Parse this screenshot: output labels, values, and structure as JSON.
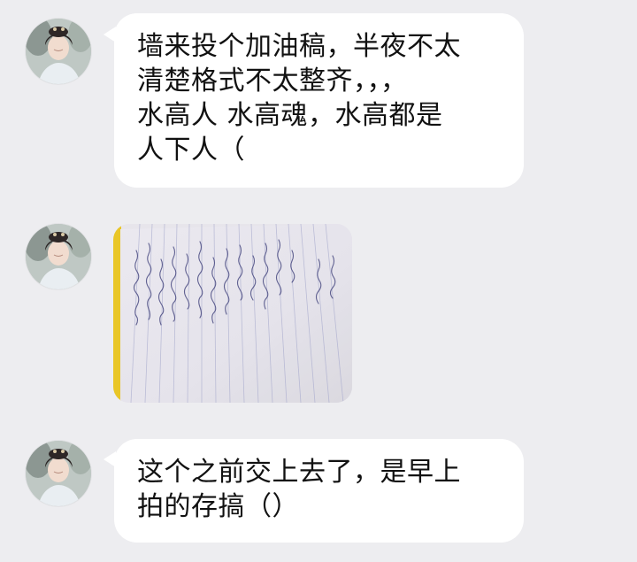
{
  "conversation": {
    "messages": [
      {
        "type": "text",
        "lines": [
          "墙来投个加油稿，半夜不太",
          "清楚格式不太整齐，，，",
          "水高人 水高魂，水高都是",
          "人下人（"
        ]
      },
      {
        "type": "image",
        "image_description": "handwritten notebook page"
      },
      {
        "type": "text",
        "lines": [
          "这个之前交上去了，是早上",
          "拍的存搞（）"
        ]
      }
    ]
  },
  "colors": {
    "background": "#ededf0",
    "bubble": "#ffffff",
    "text": "#111111",
    "notebook_edge": "#e8c31a"
  }
}
